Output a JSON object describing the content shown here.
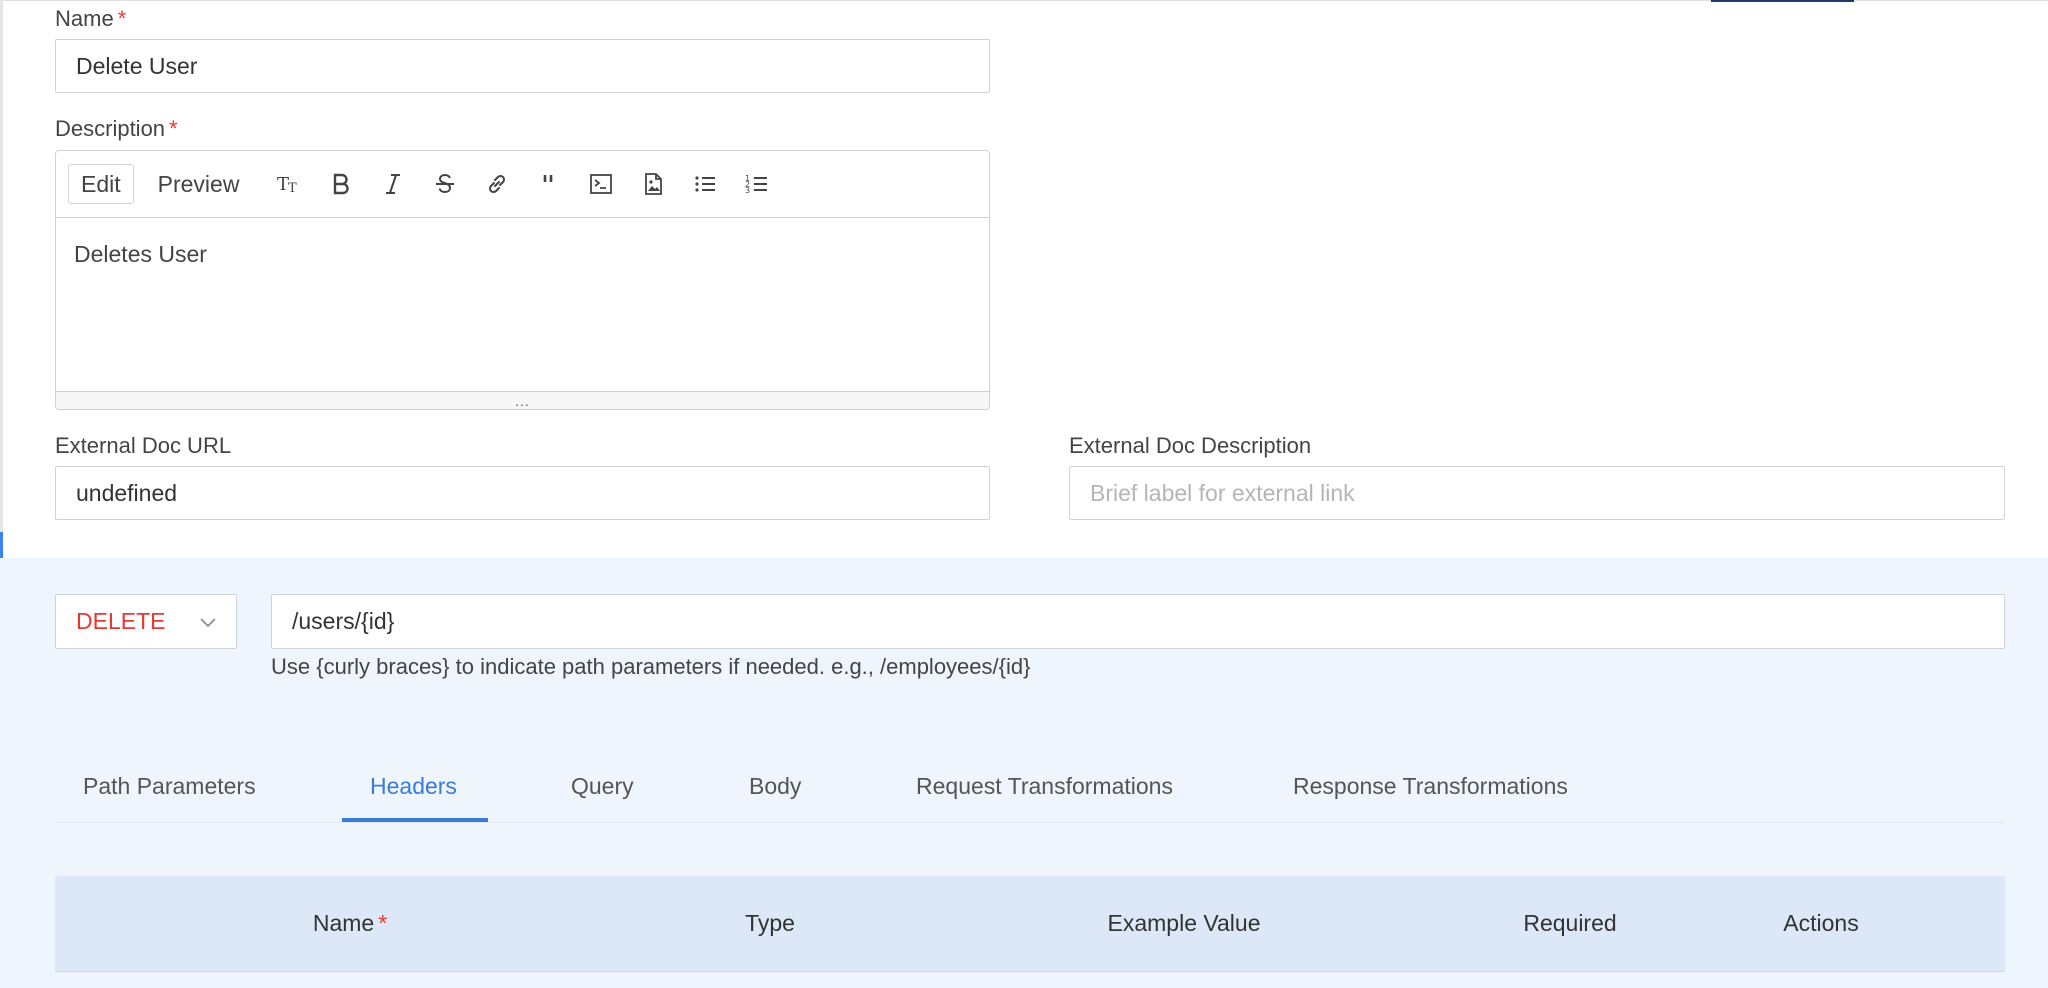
{
  "form": {
    "name_label": "Name",
    "required_mark": "*",
    "name_value": "Delete User",
    "description_label": "Description",
    "external_doc_url_label": "External Doc URL",
    "external_doc_url_value": "undefined",
    "external_doc_description_label": "External Doc Description",
    "external_doc_description_placeholder": "Brief label for external link"
  },
  "editor": {
    "tabs": [
      "Edit",
      "Preview"
    ],
    "active_tab": "Edit",
    "tools": [
      "text-size-icon",
      "bold-icon",
      "italic-icon",
      "strikethrough-icon",
      "link-icon",
      "quote-icon",
      "code-icon",
      "image-icon",
      "bullet-list-icon",
      "numbered-list-icon"
    ],
    "content": "Deletes User",
    "resize_glyph": "..."
  },
  "endpoint": {
    "method": "DELETE",
    "method_color": "#e53935",
    "path": "/users/{id}",
    "hint": "Use {curly braces} to indicate path parameters if needed. e.g., /employees/{id}"
  },
  "tabs": {
    "items": [
      "Path Parameters",
      "Headers",
      "Query",
      "Body",
      "Request Transformations",
      "Response Transformations"
    ],
    "active": "Headers",
    "accent_color": "#3a7bd5"
  },
  "table": {
    "columns": [
      "Name",
      "Type",
      "Example Value",
      "Required",
      "Actions"
    ],
    "required_mark": "*"
  }
}
